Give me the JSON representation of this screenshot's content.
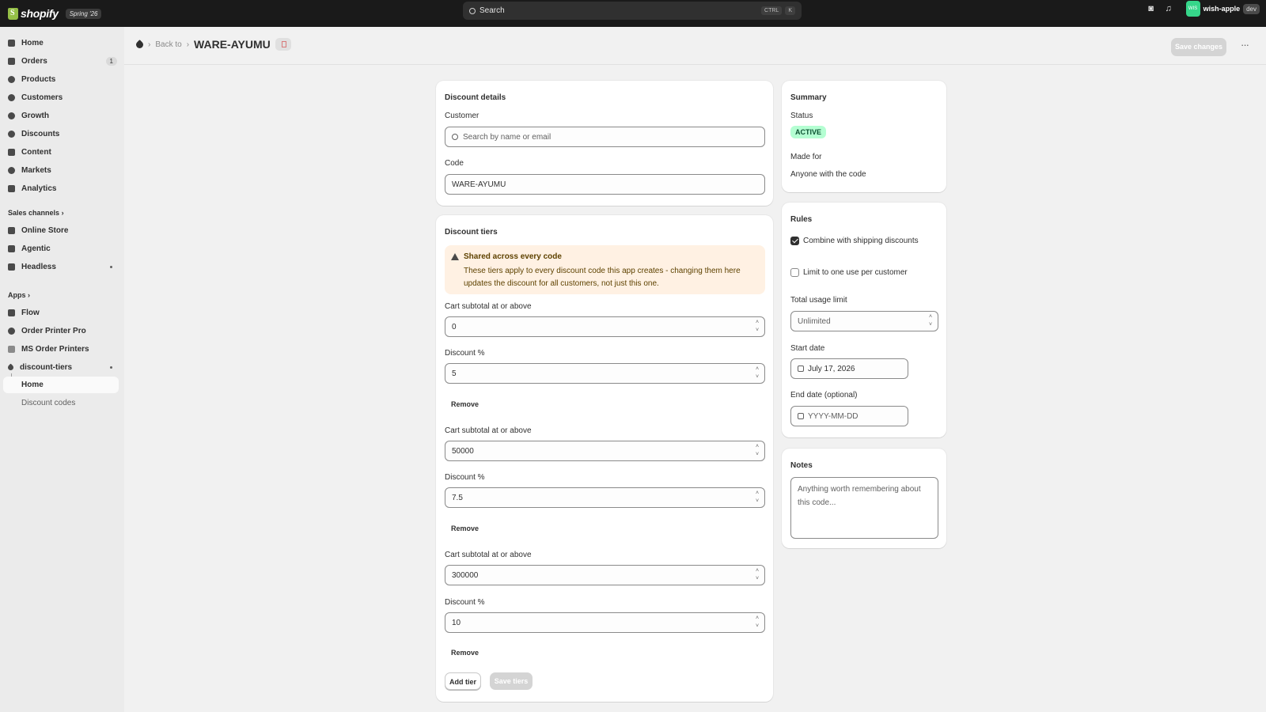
{
  "topbar": {
    "brand": "shopify",
    "edition": "Spring '26",
    "search_placeholder": "Search",
    "shortcut_key1": "CTRL",
    "shortcut_key2": "K",
    "store_initials": "WIS",
    "store_name": "wish-apple",
    "env_badge": "dev"
  },
  "sidebar": {
    "items": [
      {
        "label": "Home",
        "icon": "home-icon"
      },
      {
        "label": "Orders",
        "icon": "orders-icon",
        "badge": "1"
      },
      {
        "label": "Products",
        "icon": "products-icon"
      },
      {
        "label": "Customers",
        "icon": "customers-icon"
      },
      {
        "label": "Growth",
        "icon": "growth-icon"
      },
      {
        "label": "Discounts",
        "icon": "discounts-icon"
      },
      {
        "label": "Content",
        "icon": "content-icon"
      },
      {
        "label": "Markets",
        "icon": "markets-icon"
      },
      {
        "label": "Analytics",
        "icon": "analytics-icon"
      }
    ],
    "sales_channels_label": "Sales channels",
    "sales_channels": [
      {
        "label": "Online Store",
        "icon": "online-store-icon"
      },
      {
        "label": "Agentic",
        "icon": "agentic-icon"
      },
      {
        "label": "Headless",
        "icon": "headless-icon"
      }
    ],
    "apps_label": "Apps",
    "apps": [
      {
        "label": "Flow",
        "icon": "flow-icon"
      },
      {
        "label": "Order Printer Pro",
        "icon": "order-printer-pro-icon"
      },
      {
        "label": "MS Order Printers",
        "icon": "ms-order-printers-icon"
      },
      {
        "label": "discount-tiers",
        "icon": "tag-icon"
      }
    ],
    "app_subitems": [
      {
        "label": "Home",
        "active": true
      },
      {
        "label": "Discount codes",
        "active": false
      }
    ]
  },
  "header": {
    "back_label": "Back to",
    "title": "WARE-AYUMU",
    "save_label": "Save changes",
    "more_label": "···"
  },
  "details": {
    "title": "Discount details",
    "customer_label": "Customer",
    "customer_placeholder": "Search by name or email",
    "code_label": "Code",
    "code_value": "WARE-AYUMU"
  },
  "tiers": {
    "title": "Discount tiers",
    "warning_title": "Shared across every code",
    "warning_body": "These tiers apply to every discount code this app creates - changing them here updates the discount for all customers, not just this one.",
    "subtotal_label": "Cart subtotal at or above",
    "discount_label": "Discount %",
    "remove_label": "Remove",
    "rows": [
      {
        "subtotal": "0",
        "discount": "5"
      },
      {
        "subtotal": "50000",
        "discount": "7.5"
      },
      {
        "subtotal": "300000",
        "discount": "10"
      }
    ],
    "add_label": "Add tier",
    "save_label": "Save tiers"
  },
  "summary": {
    "title": "Summary",
    "status_label": "Status",
    "status_value": "ACTIVE",
    "made_for_label": "Made for",
    "made_for_value": "Anyone with the code"
  },
  "rules": {
    "title": "Rules",
    "combine_label": "Combine with shipping discounts",
    "combine_checked": true,
    "limit_label": "Limit to one use per customer",
    "limit_checked": false,
    "usage_label": "Total usage limit",
    "usage_placeholder": "Unlimited",
    "start_label": "Start date",
    "start_value": "July 17, 2026",
    "end_label": "End date (optional)",
    "end_placeholder": "YYYY-MM-DD"
  },
  "notes": {
    "title": "Notes",
    "placeholder": "Anything worth remembering about this code..."
  },
  "colors": {
    "topbar": "#1a1a1a",
    "accent_green": "#36d68a",
    "status_bg": "#b4fed2",
    "warning_bg": "#fff1e3"
  }
}
